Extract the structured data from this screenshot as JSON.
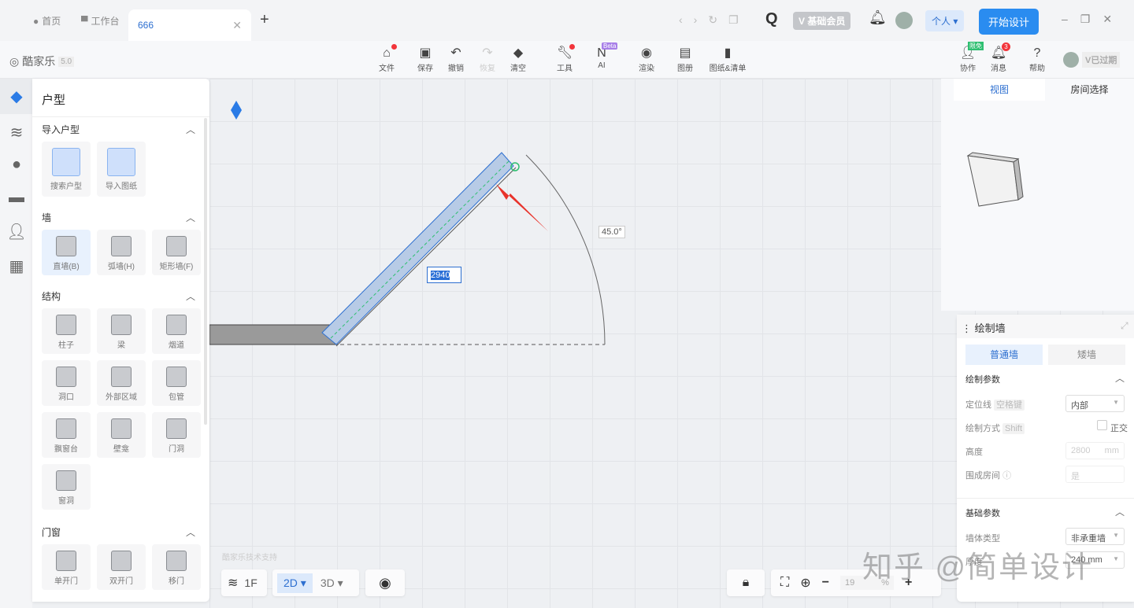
{
  "tabs": {
    "home": "首页",
    "workbench": "工作台",
    "active": "666"
  },
  "header": {
    "vip": "V 基础会员",
    "personal": "个人",
    "start": "开始设计"
  },
  "brand": {
    "name": "酷家乐",
    "version": "5.0"
  },
  "toolbar": {
    "items": [
      "文件",
      "保存",
      "撤销",
      "恢复",
      "清空",
      "工具",
      "AI",
      "渲染",
      "图册",
      "图纸&清单"
    ],
    "beta": "Beta",
    "right": [
      "协作",
      "消息",
      "帮助"
    ],
    "limited": "限免",
    "msg_count": "3",
    "expired": "V已过期"
  },
  "panel": {
    "title": "户型",
    "sections": [
      {
        "title": "导入户型",
        "items": [
          "搜索户型",
          "导入图纸"
        ]
      },
      {
        "title": "墙",
        "items": [
          "直墙(B)",
          "弧墙(H)",
          "矩形墙(F)"
        ]
      },
      {
        "title": "结构",
        "items": [
          "柱子",
          "梁",
          "烟道",
          "洞口",
          "外部区域",
          "包管",
          "飘窗台",
          "壁龛",
          "门洞",
          "窗洞"
        ]
      },
      {
        "title": "门窗",
        "items": [
          "单开门",
          "双开门",
          "移门"
        ]
      }
    ]
  },
  "canvas": {
    "angle": "45.0°",
    "length": "2940",
    "support": "酷家乐技术支持"
  },
  "preview": {
    "tabs": [
      "视图",
      "房间选择"
    ]
  },
  "draw": {
    "title": "绘制墙",
    "types": [
      "普通墙",
      "矮墙"
    ],
    "params_title": "绘制参数",
    "position_label": "定位线",
    "position_key": "空格键",
    "position_value": "内部",
    "mode_label": "绘制方式",
    "mode_key": "Shift",
    "ortho": "正交",
    "height_label": "高度",
    "height_value": "2800",
    "height_unit": "mm",
    "room_label": "围成房间",
    "room_value": "是",
    "base_title": "基础参数",
    "type_label": "墙体类型",
    "type_value": "非承重墙",
    "thick_label": "厚度",
    "thick_value": "240",
    "thick_unit": "mm"
  },
  "bottom": {
    "floor": "1F",
    "mode2d": "2D",
    "mode3d": "3D",
    "zoom": "19",
    "zoom_unit": "%"
  },
  "watermark": "知乎 @简单设计"
}
